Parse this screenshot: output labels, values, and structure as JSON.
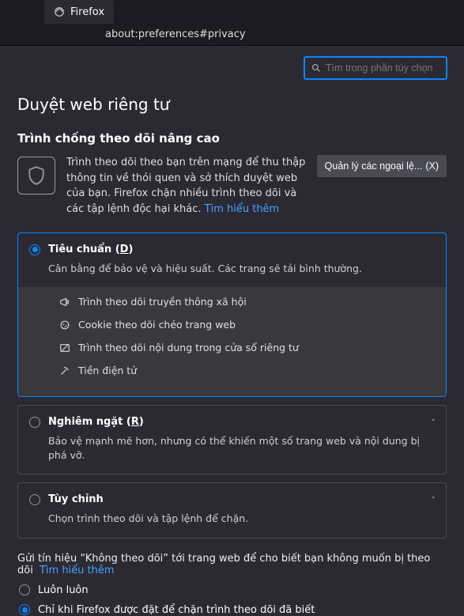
{
  "tab": {
    "title": "Firefox"
  },
  "url": "about:preferences#privacy",
  "search": {
    "placeholder": "Tìm trong phần tùy chọn"
  },
  "page": {
    "heading": "Duyệt web riêng tư",
    "etp_heading": "Trình chống theo dõi nâng cao",
    "etp_desc": "Trình theo dõi theo bạn trên mạng để thu thập thông tin về thói quen và sở thích duyệt web của bạn. Firefox chặn nhiều trình theo dõi và các tập lệnh độc hại khác.",
    "learn_more": "Tìm hiểu thêm",
    "exceptions_btn": "Quản lý các ngoại lệ...",
    "exceptions_key": "(X)"
  },
  "options": {
    "standard": {
      "title_pre": "Tiêu chuẩn (",
      "title_key": "D",
      "title_post": ")",
      "desc": "Cân bằng để bảo vệ và hiệu suất. Các trang sẽ tải bình thường.",
      "features": {
        "social": "Trình theo dõi truyền thông xã hội",
        "cookies": "Cookie theo dõi chéo trang web",
        "private": "Trình theo dõi nội dung trong cửa sổ riêng tư",
        "crypto": "Tiền điện tử"
      }
    },
    "strict": {
      "title_pre": "Nghiêm ngặt (",
      "title_key": "R",
      "title_post": ")",
      "desc": "Bảo vệ mạnh mẽ hơn, nhưng có thể khiến một số trang web và nội dung bị phá vỡ."
    },
    "custom": {
      "title": "Tùy chỉnh",
      "desc": "Chọn trình theo dõi và tập lệnh để chặn."
    }
  },
  "dnt": {
    "text": "Gửi tín hiệu “Không theo dõi” tới trang web để cho biết bạn không muốn bị theo dõi",
    "learn_more": "Tìm hiểu thêm",
    "always": "Luôn luôn",
    "only_when": "Chỉ khi Firefox được đặt để chặn trình theo dõi đã biết"
  }
}
